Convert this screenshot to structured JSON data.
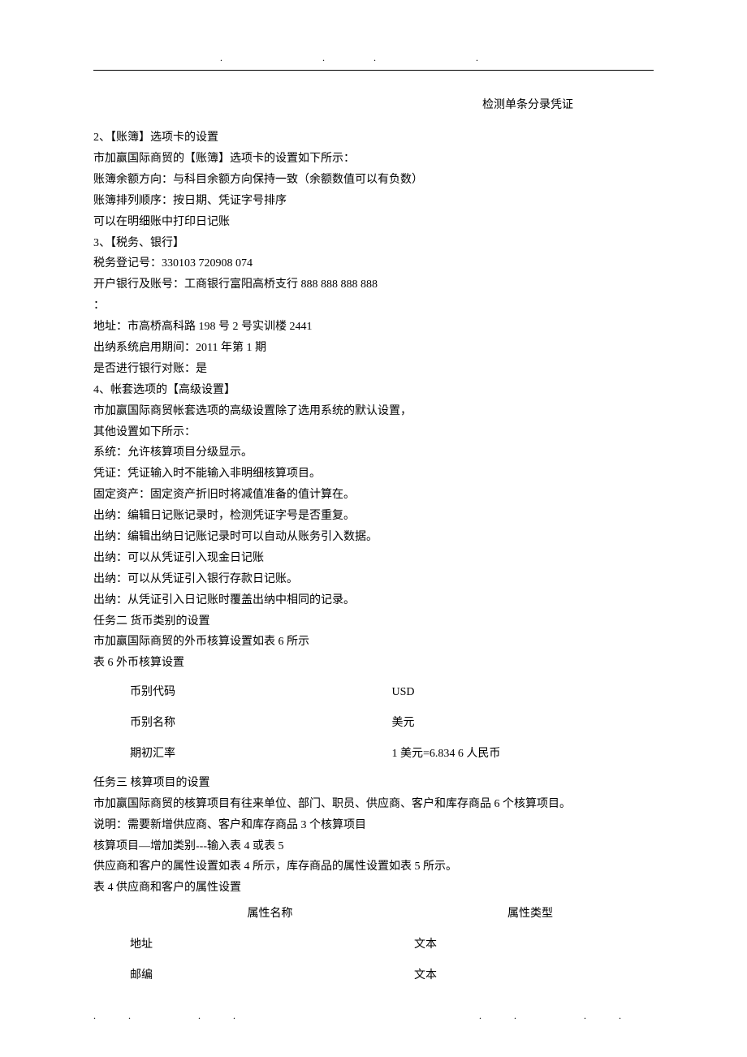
{
  "header_dots": ". .. .",
  "right_label": "检测单条分录凭证",
  "lines": [
    "2、【账簿】选项卡的设置",
    "市加赢国际商贸的【账簿】选项卡的设置如下所示：",
    "账簿余额方向：与科目余额方向保持一致（余额数值可以有负数）",
    "账簿排列顺序：按日期、凭证字号排序",
    "可以在明细账中打印日记账",
    "3、【税务、银行】",
    "税务登记号：330103 720908 074",
    "开户银行及账号：工商银行富阳高桥支行 888 888 888 888",
    "：",
    "地址：市高桥高科路 198 号 2 号实训楼 2441",
    "出纳系统启用期间：2011 年第 1 期",
    "是否进行银行对账：是",
    "4、帐套选项的【高级设置】",
    "市加赢国际商贸帐套选项的高级设置除了选用系统的默认设置，",
    "其他设置如下所示：",
    "系统：允许核算项目分级显示。",
    "凭证：凭证输入时不能输入非明细核算项目。",
    "固定资产：固定资产折旧时将减值准备的值计算在。",
    "出纳：编辑日记账记录时，检测凭证字号是否重复。",
    "出纳：编辑出纳日记账记录时可以自动从账务引入数据。",
    "出纳：可以从凭证引入现金日记账",
    "出纳：可以从凭证引入银行存款日记账。",
    "出纳：从凭证引入日记账时覆盖出纳中相同的记录。",
    "任务二 货币类别的设置",
    "市加赢国际商贸的外币核算设置如表 6 所示",
    "表 6 外币核算设置"
  ],
  "currency_table": {
    "rows": [
      {
        "label": "币别代码",
        "value": "USD"
      },
      {
        "label": "币别名称",
        "value": "美元"
      },
      {
        "label": "期初汇率",
        "value": "1 美元=6.834 6 人民币"
      }
    ]
  },
  "lines2": [
    "任务三 核算项目的设置",
    "市加赢国际商贸的核算项目有往来单位、部门、职员、供应商、客户和库存商品 6 个核算项目。",
    "说明：需要新增供应商、客户和库存商品 3 个核算项目",
    "核算项目—增加类别---输入表 4 或表 5",
    "供应商和客户的属性设置如表 4 所示，库存商品的属性设置如表 5 所示。",
    "表 4 供应商和客户的属性设置"
  ],
  "attr_table": {
    "header": {
      "col1": "属性名称",
      "col2": "属性类型"
    },
    "rows": [
      {
        "name": "地址",
        "type": "文本"
      },
      {
        "name": "邮编",
        "type": "文本"
      }
    ]
  },
  "footer_dots_left": ".. ..",
  "footer_dots_right": ".. .."
}
